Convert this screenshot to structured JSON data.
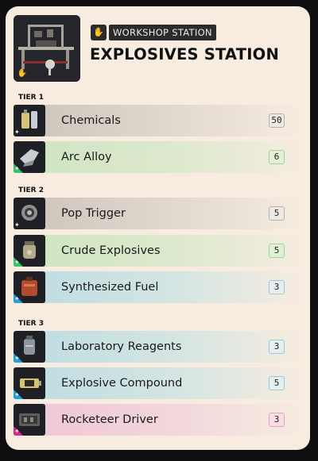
{
  "header": {
    "category_label": "WORKSHOP STATION",
    "category_icon": "hand-icon",
    "title": "EXPLOSIVES STATION",
    "thumbnail": "workbench-image"
  },
  "tiers": [
    {
      "label": "TIER 1",
      "items": [
        {
          "name": "Chemicals",
          "qty": "50",
          "rarity": "gray",
          "icon": "chemical-bottles-icon"
        },
        {
          "name": "Arc Alloy",
          "qty": "6",
          "rarity": "green",
          "icon": "arc-alloy-icon"
        }
      ]
    },
    {
      "label": "TIER 2",
      "items": [
        {
          "name": "Pop Trigger",
          "qty": "5",
          "rarity": "gray",
          "icon": "gear-trigger-icon"
        },
        {
          "name": "Crude Explosives",
          "qty": "5",
          "rarity": "green",
          "icon": "jar-icon"
        },
        {
          "name": "Synthesized Fuel",
          "qty": "3",
          "rarity": "blue",
          "icon": "fuel-canister-icon"
        }
      ]
    },
    {
      "label": "TIER 3",
      "items": [
        {
          "name": "Laboratory Reagents",
          "qty": "3",
          "rarity": "blue",
          "icon": "reagent-flask-icon"
        },
        {
          "name": "Explosive Compound",
          "qty": "5",
          "rarity": "blue",
          "icon": "battery-icon"
        },
        {
          "name": "Rocketeer Driver",
          "qty": "3",
          "rarity": "pink",
          "icon": "engine-icon"
        }
      ]
    }
  ],
  "colors": {
    "card_background": "#f7ecdf",
    "uncommon": "#36c06a",
    "rare": "#1f9fe0",
    "epic": "#e0268a"
  }
}
